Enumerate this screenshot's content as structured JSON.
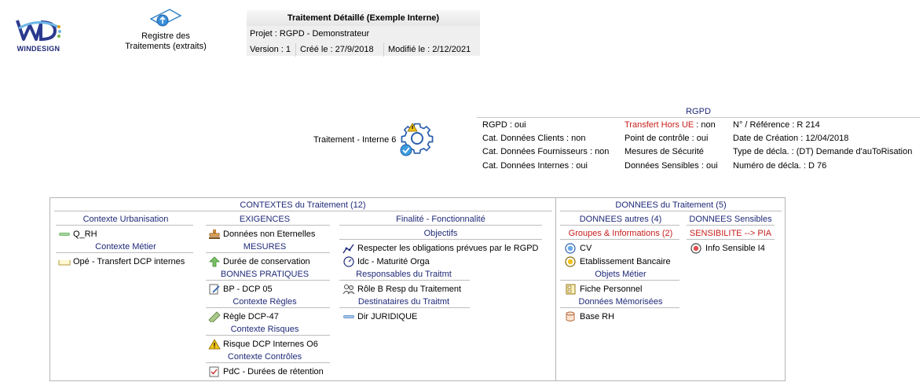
{
  "logo": {
    "text": "WINDESIGN"
  },
  "registre": {
    "label_line1": "Registre des",
    "label_line2": "Traitements (extraits)"
  },
  "header": {
    "title": "Traitement Détaillé (Exemple Interne)",
    "projet": "Projet : RGPD - Demonstrateur",
    "version": "Version : 1",
    "cree": "Créé le : 27/9/2018",
    "modifie": "Modifié le : 2/12/2021"
  },
  "rgpd": {
    "title": "RGPD",
    "col1": [
      "RGPD : oui",
      "Cat. Données Clients : non",
      "Cat. Données Fournisseurs : non",
      "Cat. Données Internes : oui"
    ],
    "transfert_label": "Transfert Hors UE",
    "transfert_value": " : non",
    "col2_rest": [
      "Point de contrôle : oui",
      "Mesures de Sécurité",
      "Données Sensibles : oui"
    ],
    "col3": [
      "N° / Référence : R 214",
      "Date de Création : 12/04/2018",
      "Type de décla. : (DT) Demande d'auToRisation",
      "Numéro de décla. : D 76"
    ]
  },
  "traitement": {
    "label": "Traitement - Interne 6"
  },
  "contextes": {
    "header": "CONTEXTES du Traitement (12)",
    "col1": {
      "urbanisation": {
        "title": "Contexte Urbanisation",
        "items": [
          "Q_RH"
        ]
      },
      "metier": {
        "title": "Contexte Métier",
        "items": [
          "Opé - Transfert DCP internes"
        ]
      }
    },
    "col2": {
      "exigences": {
        "title": "EXIGENCES",
        "items": [
          "Données non Eternelles"
        ]
      },
      "mesures": {
        "title": "MESURES",
        "items": [
          "Durée de conservation"
        ]
      },
      "bonnes": {
        "title": "BONNES PRATIQUES",
        "items": [
          "BP - DCP 05"
        ]
      },
      "regles": {
        "title": "Contexte Règles",
        "items": [
          "Règle DCP-47"
        ]
      },
      "risques": {
        "title": "Contexte Risques",
        "items": [
          "Risque DCP Internes O6"
        ]
      },
      "controles": {
        "title": "Contexte Contrôles",
        "items": [
          "PdC - Durées de rétention"
        ]
      }
    },
    "col3": {
      "finalite": {
        "title": "Finalité - Fonctionnalité"
      },
      "objectifs": {
        "title": "Objectifs",
        "items": [
          "Respecter les obligations prévues par le RGPD",
          "Idc - Maturité Orga"
        ]
      },
      "responsables": {
        "title": "Responsables du Traitmt",
        "items": [
          "Rôle B Resp du Traitement"
        ]
      },
      "destinataires": {
        "title": "Destinataires du Traitmt",
        "items": [
          "Dir JURIDIQUE"
        ]
      }
    }
  },
  "donnees": {
    "header": "DONNEES du Traitement (5)",
    "autres": {
      "title": "DONNEES autres (4)",
      "groupes": {
        "title": "Groupes & Informations (2)",
        "items": [
          "CV",
          "Etablissement Bancaire"
        ]
      },
      "objets": {
        "title": "Objets Métier",
        "items": [
          "Fiche Personnel"
        ]
      },
      "memorisees": {
        "title": "Données Mémorisées",
        "items": [
          "Base RH"
        ]
      }
    },
    "sensibles": {
      "title": "DONNEES Sensibles",
      "sensibilite": {
        "title": "SENSIBILITE --> PIA",
        "items": [
          "Info Sensible I4"
        ]
      }
    }
  },
  "colors": {
    "navy": "#1f2a78",
    "red": "#c8201e",
    "border": "#b5b5b5"
  }
}
